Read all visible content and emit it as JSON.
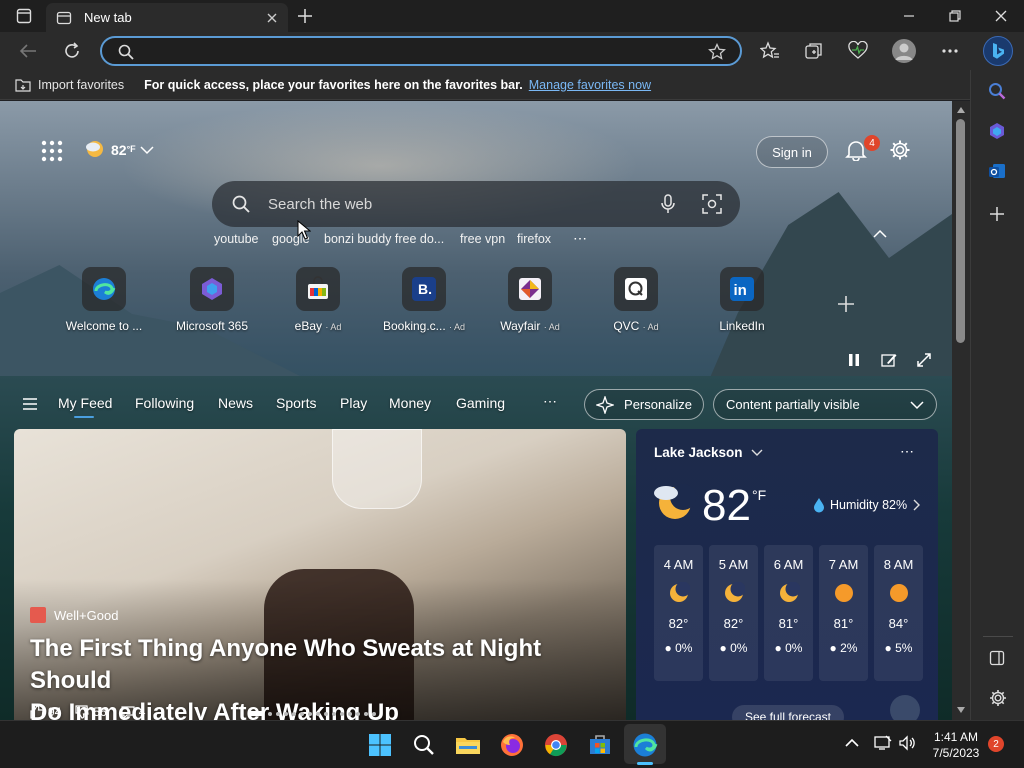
{
  "browser": {
    "tab_title": "New tab",
    "address_value": "",
    "favorites_bar": {
      "import_label": "Import favorites",
      "message": "For quick access, place your favorites here on the favorites bar.",
      "manage_link": "Manage favorites now"
    },
    "profile_badge": ""
  },
  "newtab": {
    "weather_chip": {
      "temp": "82",
      "unit": "°F"
    },
    "sign_in_label": "Sign in",
    "notifications_count": "4",
    "search_placeholder": "Search the web",
    "suggestions": [
      "youtube",
      "google",
      "bonzi buddy free do...",
      "free vpn",
      "firefox"
    ],
    "quick_links": [
      {
        "label": "Welcome to ...",
        "ad": ""
      },
      {
        "label": "Microsoft 365",
        "ad": ""
      },
      {
        "label": "eBay",
        "ad": "· Ad"
      },
      {
        "label": "Booking.c...",
        "ad": "· Ad"
      },
      {
        "label": "Wayfair",
        "ad": "· Ad"
      },
      {
        "label": "QVC",
        "ad": "· Ad"
      },
      {
        "label": "LinkedIn",
        "ad": ""
      }
    ],
    "feed_tabs": [
      "My Feed",
      "Following",
      "News",
      "Sports",
      "Play",
      "Money",
      "Gaming"
    ],
    "personalize_label": "Personalize",
    "content_visibility_label": "Content partially visible"
  },
  "hero": {
    "source": "Well+Good",
    "headline_line1": "The First Thing Anyone Who Sweats at Night Should",
    "headline_line2": "Do Immediately After Waking Up",
    "likes": "94",
    "dislikes": "56",
    "comments": "4"
  },
  "weather": {
    "location": "Lake Jackson",
    "temp": "82",
    "unit": "°F",
    "humidity": "Humidity 82%",
    "forecast_link": "See full forecast",
    "hourly": [
      {
        "time": "4 AM",
        "temp": "82°",
        "precip": "0%",
        "icon": "moon"
      },
      {
        "time": "5 AM",
        "temp": "82°",
        "precip": "0%",
        "icon": "moon"
      },
      {
        "time": "6 AM",
        "temp": "81°",
        "precip": "0%",
        "icon": "moon"
      },
      {
        "time": "7 AM",
        "temp": "81°",
        "precip": "2%",
        "icon": "sun"
      },
      {
        "time": "8 AM",
        "temp": "84°",
        "precip": "5%",
        "icon": "sun"
      }
    ]
  },
  "taskbar": {
    "time": "1:41 AM",
    "date": "7/5/2023",
    "notification_count": "2"
  },
  "colors": {
    "accent": "#4a9fe0",
    "link": "#7ab8f5",
    "badge": "#e0452b"
  }
}
